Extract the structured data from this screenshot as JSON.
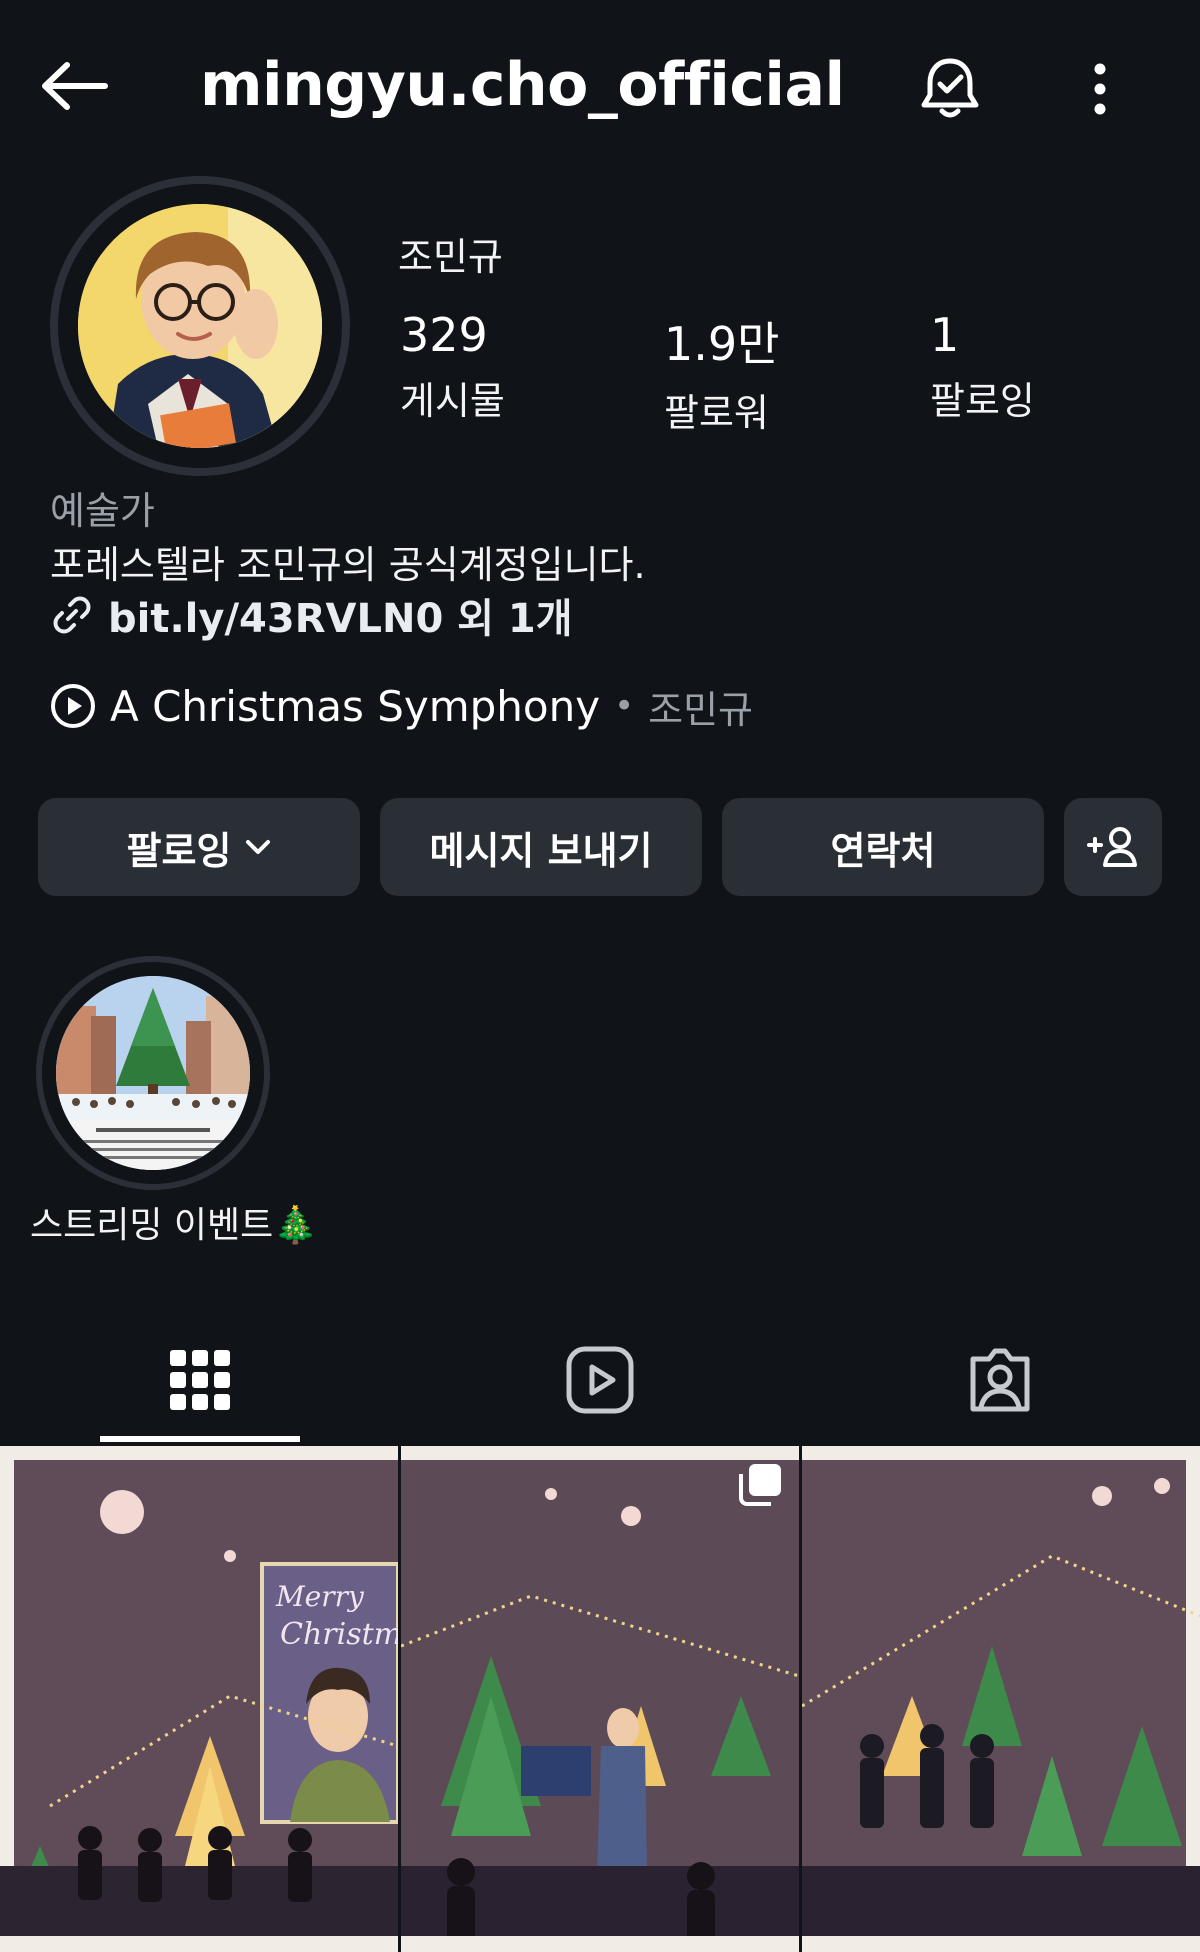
{
  "header": {
    "username": "mingyu.cho_official",
    "back_icon": "arrow-left-icon",
    "notification_icon": "bell-check-icon",
    "more_icon": "more-vertical-icon"
  },
  "profile": {
    "display_name": "조민규",
    "stats": {
      "posts": {
        "value": "329",
        "label": "게시물"
      },
      "followers": {
        "value": "1.9만",
        "label": "팔로워"
      },
      "following": {
        "value": "1",
        "label": "팔로잉"
      }
    },
    "category": "예술가",
    "bio": "포레스텔라 조민규의 공식계정입니다.",
    "link": "bit.ly/43RVLN0 외 1개",
    "music": {
      "song": "A Christmas Symphony",
      "separator": "•",
      "artist": "조민규"
    }
  },
  "actions": {
    "follow_label": "팔로잉",
    "message_label": "메시지 보내기",
    "contact_label": "연락처"
  },
  "highlights": [
    {
      "label": "스트리밍 이벤트🎄"
    }
  ],
  "tabs": [
    "grid-icon",
    "reels-icon",
    "tagged-icon"
  ],
  "colors": {
    "background": "#101318",
    "button": "#2a2f36",
    "muted_text": "#9aa0a8"
  }
}
